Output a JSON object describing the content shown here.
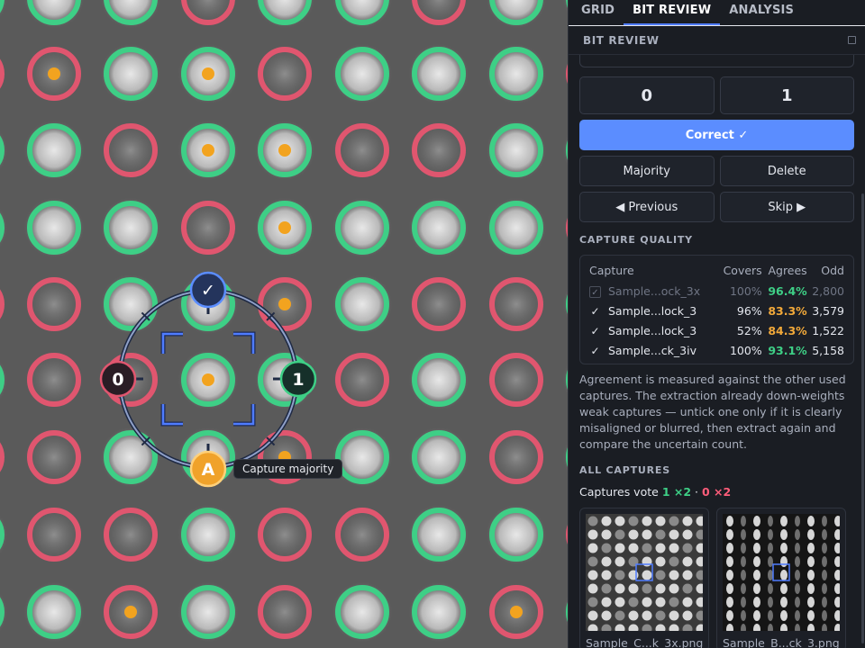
{
  "tabs": [
    {
      "label": "GRID",
      "active": false
    },
    {
      "label": "BIT REVIEW",
      "active": true
    },
    {
      "label": "ANALYSIS",
      "active": false
    }
  ],
  "section_title": "BIT REVIEW",
  "bit_buttons": {
    "zero": "0",
    "one": "1"
  },
  "correct_label": "Correct ✓",
  "actions": {
    "majority": "Majority",
    "delete": "Delete",
    "previous": "◀ Previous",
    "skip": "Skip ▶"
  },
  "capture_quality": {
    "label": "CAPTURE QUALITY",
    "headers": {
      "capture": "Capture",
      "covers": "Covers",
      "agrees": "Agrees",
      "odd": "Odd"
    },
    "rows": [
      {
        "checked": false,
        "name": "Sample...ock_3x",
        "covers": "100%",
        "agrees": "96.4%",
        "odd": "2,800"
      },
      {
        "checked": true,
        "name": "Sample...lock_3",
        "covers": "96%",
        "agrees": "83.3%",
        "odd": "3,579"
      },
      {
        "checked": true,
        "name": "Sample...lock_3",
        "covers": "52%",
        "agrees": "84.3%",
        "odd": "1,522"
      },
      {
        "checked": true,
        "name": "Sample...ck_3iv",
        "covers": "100%",
        "agrees": "93.1%",
        "odd": "5,158"
      }
    ],
    "note": "Agreement is measured against the other used captures. The extraction already down-weights weak captures — untick one only if it is clearly misaligned or blurred, then extract again and compare the uncertain count."
  },
  "all_captures": {
    "label": "ALL CAPTURES",
    "vote_prefix": "Captures vote",
    "vote_one": "1 ×2",
    "vote_sep": "·",
    "vote_zero": "0 ×2",
    "thumbs": [
      {
        "caption": "Sample_C...k_3x.png"
      },
      {
        "caption": "Sample_B...ck_3.png"
      }
    ]
  },
  "radial_menu": {
    "correct_glyph": "✓",
    "zero": "0",
    "one": "1",
    "auto": "A",
    "tooltip": "Capture majority"
  },
  "colors": {
    "accent": "#5b8dff",
    "bit_one": "#3ecf86",
    "bit_zero": "#e0566f",
    "marker": "#f2a31f"
  }
}
